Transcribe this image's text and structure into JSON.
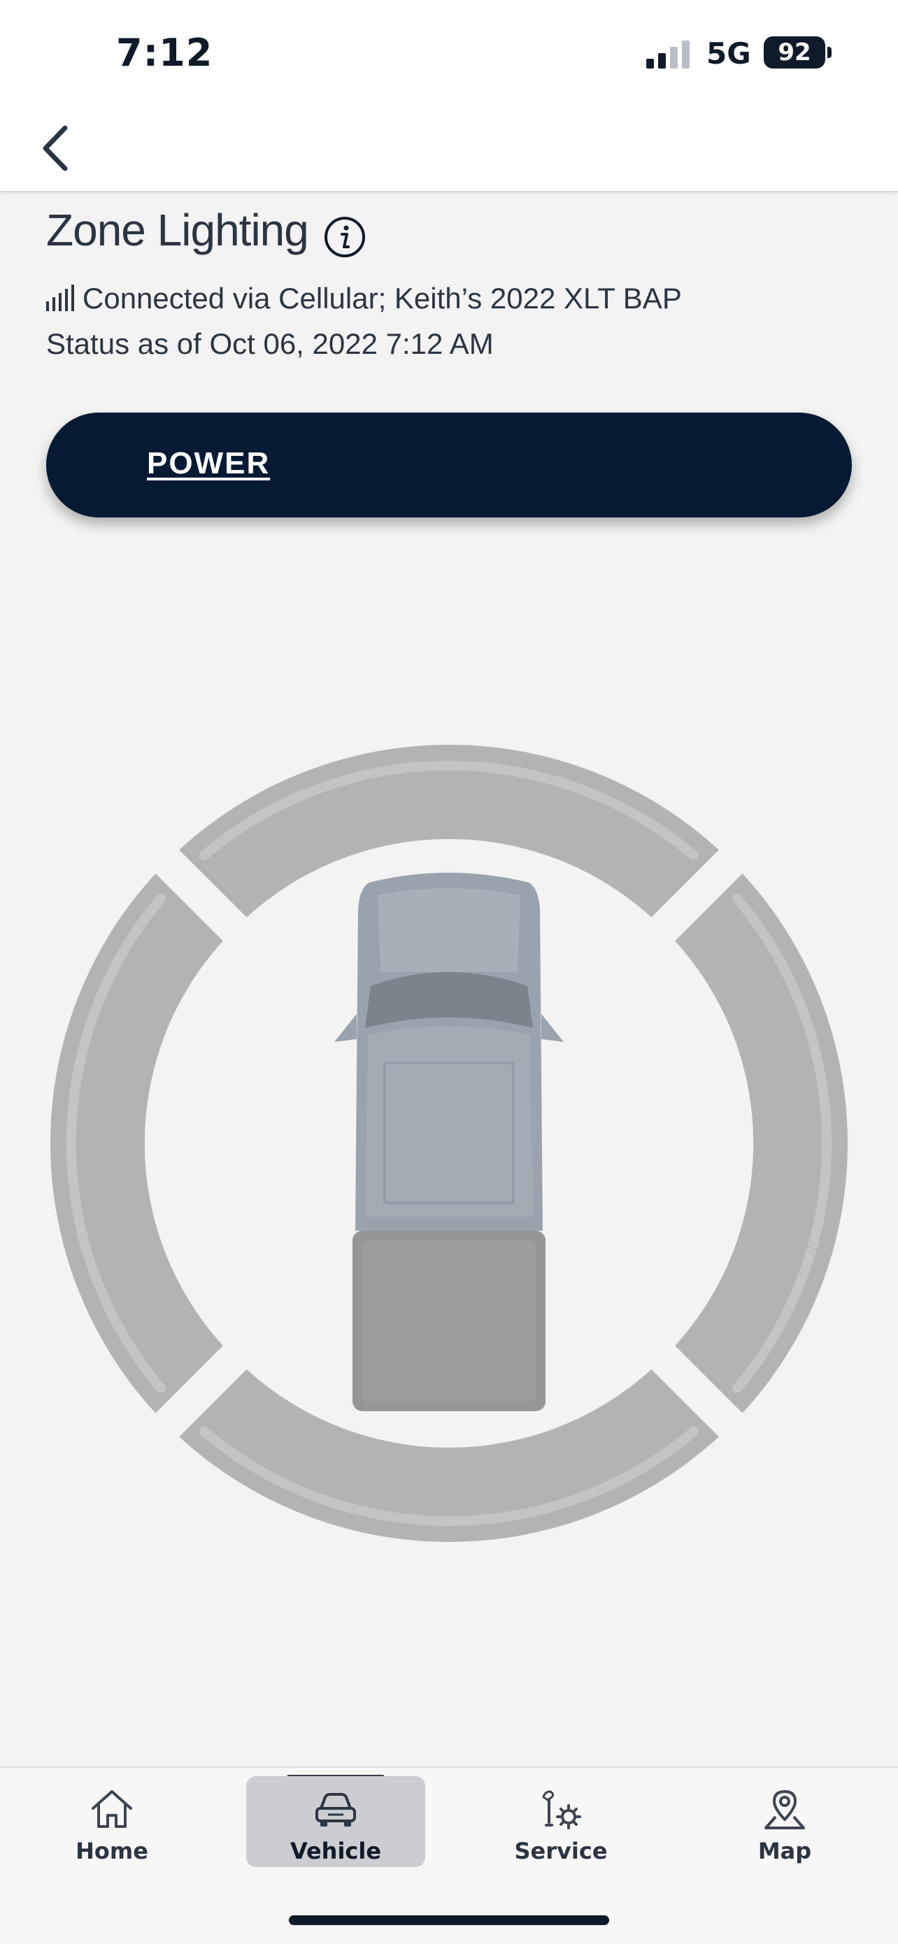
{
  "status_bar": {
    "time": "7:12",
    "network": "5G",
    "battery": "92"
  },
  "header": {
    "back_icon": "chevron-left-icon"
  },
  "page": {
    "title": "Zone Lighting",
    "connection": "Connected via Cellular; Keith’s 2022 XLT BAP",
    "status": "Status as of Oct 06, 2022 7:12 AM"
  },
  "power_button": {
    "label": "POWER"
  },
  "zones": {
    "color_inactive": "#b3b3b3",
    "color_highlight": "#c4c4c4",
    "items": [
      "front-zone",
      "right-zone",
      "rear-zone",
      "left-zone"
    ]
  },
  "tabs": [
    {
      "label": "Home",
      "icon": "home-icon"
    },
    {
      "label": "Vehicle",
      "icon": "car-icon",
      "active": true
    },
    {
      "label": "Service",
      "icon": "service-gear-icon"
    },
    {
      "label": "Map",
      "icon": "map-pin-icon"
    }
  ],
  "colors": {
    "primary": "#061a33",
    "background": "#f3f3f3",
    "text": "#2b3542"
  }
}
